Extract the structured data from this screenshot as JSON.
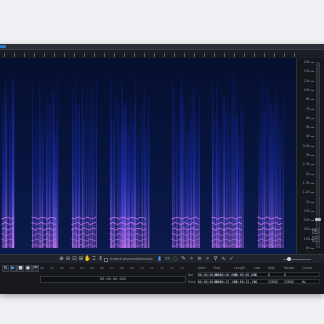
{
  "colors": {
    "accent": "#4da3ff",
    "spectrogram_bg": "#061338",
    "signal_low": "#1e3cff",
    "signal_high": "#d27cff"
  },
  "frequency_scale": [
    "20k",
    "15k",
    "12k",
    "10k",
    "8k",
    "7k",
    "6k",
    "5k",
    "4k",
    "3.5k",
    "3k",
    "2.5k",
    "2k",
    "1.5k",
    "1.2k",
    "1k",
    "700",
    "500",
    "300",
    "100",
    "Hz"
  ],
  "scale_zoom": {
    "zoom_in": "+",
    "zoom_out": "−"
  },
  "toolbar": {
    "tools": [
      {
        "name": "zoom-in-tool",
        "glyph": "⊕"
      },
      {
        "name": "zoom-out-tool",
        "glyph": "⊖"
      },
      {
        "name": "zoom-selection-tool",
        "glyph": "⊡"
      },
      {
        "name": "zoom-fit-tool",
        "glyph": "⊞"
      },
      {
        "name": "hand-tool",
        "glyph": "✋"
      },
      {
        "name": "time-selection-tool",
        "glyph": "⌶"
      },
      {
        "name": "frequency-selection-tool",
        "glyph": "⇕"
      }
    ],
    "checkbox_label": "Instant process",
    "mode_label": "Attenuate",
    "right_tools": [
      {
        "name": "select-tool",
        "glyph": "▮",
        "active": true
      },
      {
        "name": "box-select-tool",
        "glyph": "▭"
      },
      {
        "name": "lasso-tool",
        "glyph": "◌"
      },
      {
        "name": "brush-tool",
        "glyph": "✎"
      },
      {
        "name": "magic-wand-tool",
        "glyph": "✧"
      },
      {
        "name": "harmonic-select-tool",
        "glyph": "≋"
      },
      {
        "name": "find-similar-tool",
        "glyph": "⌕"
      },
      {
        "name": "zoom-tool",
        "glyph": "⚲"
      },
      {
        "name": "gain-tool",
        "glyph": "∿"
      },
      {
        "name": "checkmark-tool",
        "glyph": "✓"
      }
    ]
  },
  "transport": [
    {
      "name": "loop-button",
      "glyph": "↻"
    },
    {
      "name": "play-button",
      "glyph": "▶"
    },
    {
      "name": "stop-button",
      "glyph": "■"
    },
    {
      "name": "record-button",
      "glyph": "●"
    },
    {
      "name": "rewind-button",
      "glyph": "⏮"
    }
  ],
  "timeline": [
    "00",
    "01",
    "02",
    "03",
    "04",
    "05",
    "06",
    "07",
    "08",
    "09",
    "10",
    "11",
    "12",
    "13",
    "14"
  ],
  "timecode": "00:00:00.000",
  "info": {
    "headers": [
      "Start",
      "End",
      "Length",
      "Low",
      "High",
      "Range",
      "Cursor"
    ],
    "rows": [
      {
        "label": "Sel",
        "values": [
          "00:00:00.000",
          "00:00:00.000",
          "00:00:00.000",
          "0",
          "0",
          "0",
          ""
        ]
      },
      {
        "label": "View",
        "values": [
          "00:00:00.000",
          "00:00:15.154",
          "00:00:15.154",
          "0",
          "22050",
          "22050",
          "Hz"
        ]
      }
    ]
  }
}
